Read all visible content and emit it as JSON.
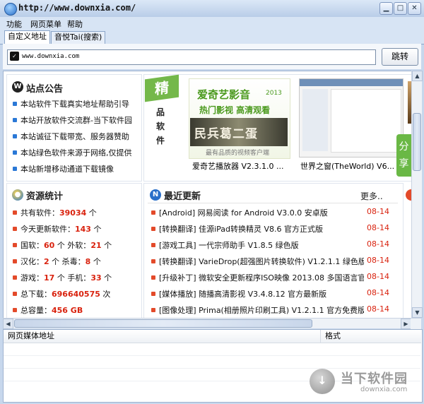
{
  "window": {
    "title": "http://www.downxia.com/"
  },
  "menus": [
    "功能",
    "网页菜单",
    "帮助"
  ],
  "tabs": [
    "自定义地址",
    "音悦Tai(搜索)"
  ],
  "address": {
    "value": "www.downxia.com",
    "go_label": "跳转"
  },
  "notice": {
    "title": "站点公告",
    "items": [
      "本站软件下载真实地址帮助引导",
      "本站开放软件交流群-当下软件园",
      "本站诚征下载带宽、服务器赞助",
      "本站绿色软件来源于网络,仅提供",
      "本站新增移动通道下载镜像"
    ]
  },
  "featured": {
    "badge_char": "精",
    "badge_text": "品软件",
    "banner_title": "爱奇艺影音",
    "banner_year": "2013",
    "banner_sub": "热门影视 高清观看",
    "banner_calligraphy": "民兵葛二蛋",
    "banner_slogan": "最有品质的视频客户端",
    "app1_caption": "爱奇艺播放器 V2.3.1.0 ...",
    "app2_caption": "世界之窗(TheWorld) V6..."
  },
  "stats": {
    "title": "资源统计",
    "rows": [
      {
        "label": "共有软件：",
        "value": "39034",
        "unit": "个"
      },
      {
        "label": "今天更新软件：",
        "value": "143",
        "unit": "个"
      },
      {
        "label": "国软：",
        "value": "60",
        "unit": "个",
        "label2": "外软：",
        "value2": "21",
        "unit2": "个"
      },
      {
        "label": "汉化：",
        "value": "2",
        "unit": "个",
        "label2": "杀毒：",
        "value2": "8",
        "unit2": "个"
      },
      {
        "label": "游戏：",
        "value": "17",
        "unit": "个",
        "label2": "手机：",
        "value2": "33",
        "unit2": "个"
      },
      {
        "label": "总下载：",
        "value": "696640575",
        "unit": "次"
      },
      {
        "label": "总容量：",
        "value": "456 GB",
        "unit": ""
      }
    ]
  },
  "updates": {
    "title": "最近更新",
    "more": "更多..",
    "items": [
      {
        "text": "[Android] 网易阅读 for Android V3.0.0 安卓版",
        "date": "08-14"
      },
      {
        "text": "[转换翻译] 佳源iPad转换精灵 V8.6 官方正式版",
        "date": "08-14"
      },
      {
        "text": "[游戏工具] 一代宗师助手 V1.8.5 绿色版",
        "date": "08-14"
      },
      {
        "text": "[转换翻译] VarieDrop(超强图片转换软件) V1.2.1.1 绿色版",
        "date": "08-14"
      },
      {
        "text": "[升级补丁] 微软安全更新程序ISO映像 2013.08 多国语言官",
        "date": "08-14"
      },
      {
        "text": "[媒体播放] 随播高清影视 V3.4.8.12 官方最新版",
        "date": "08-14"
      },
      {
        "text": "[图像处理] Prima(相册照片印刷工具) V1.2.1.1 官方免费版",
        "date": "08-14"
      }
    ]
  },
  "share_label": "分享",
  "list": {
    "columns": [
      "网页媒体地址",
      "格式"
    ]
  },
  "watermark": {
    "name": "当下软件园",
    "url": "downxia.com"
  },
  "colors": {
    "accent_red": "#d9220e",
    "share_green": "#6ab845",
    "badge_green": "#74b84a"
  }
}
